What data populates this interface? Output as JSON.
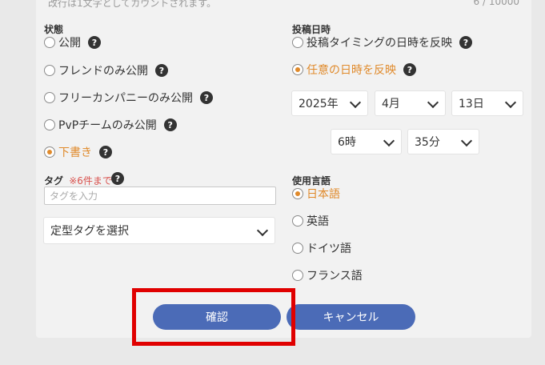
{
  "top_note": "改行は1文字としてカウントされます。",
  "char_counter": "6 / 10000",
  "status": {
    "title": "状態",
    "options": [
      {
        "label": "公開",
        "selected": false
      },
      {
        "label": "フレンドのみ公開",
        "selected": false
      },
      {
        "label": "フリーカンパニーのみ公開",
        "selected": false
      },
      {
        "label": "PvPチームのみ公開",
        "selected": false
      },
      {
        "label": "下書き",
        "selected": true
      }
    ]
  },
  "post_date": {
    "title": "投稿日時",
    "options": [
      {
        "label": "投稿タイミングの日時を反映",
        "selected": false
      },
      {
        "label": "任意の日時を反映",
        "selected": true
      }
    ],
    "year": "2025年",
    "month": "4月",
    "day": "13日",
    "hour": "6時",
    "minute": "35分"
  },
  "tags": {
    "title": "タグ",
    "limit_note": "※6件まで",
    "placeholder": "タグを入力",
    "preset_select": "定型タグを選択"
  },
  "language": {
    "title": "使用言語",
    "options": [
      {
        "label": "日本語",
        "selected": true
      },
      {
        "label": "英語",
        "selected": false
      },
      {
        "label": "ドイツ語",
        "selected": false
      },
      {
        "label": "フランス語",
        "selected": false
      }
    ]
  },
  "buttons": {
    "confirm": "確認",
    "cancel": "キャンセル"
  },
  "help_glyph": "?",
  "colors": {
    "accent": "#e08a2b",
    "button": "#4b6bb7",
    "highlight": "#e00000",
    "tag_limit": "#d9534f"
  }
}
